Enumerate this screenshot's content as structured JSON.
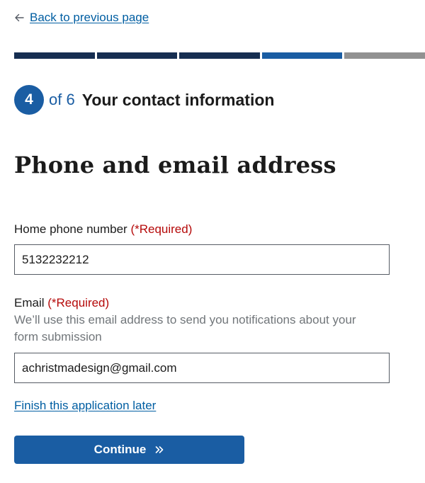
{
  "nav": {
    "back_label": "Back to previous page",
    "back_icon": "arrow-left-icon"
  },
  "progress": {
    "total_segments": 5,
    "segments": [
      "done",
      "done",
      "done",
      "current",
      "todo"
    ],
    "colors": {
      "done": "#162e51",
      "current": "#1a5da3",
      "todo": "#919191"
    }
  },
  "step": {
    "number": "4",
    "of_label": "of 6",
    "title": "Your contact information"
  },
  "page": {
    "title": "Phone and email address"
  },
  "form": {
    "phone": {
      "label": "Home phone number",
      "required_label": "(*Required)",
      "value": "5132232212"
    },
    "email": {
      "label": "Email",
      "required_label": "(*Required)",
      "hint": "We’ll use this email address to send you notifications about your form submission",
      "value": "achristmadesign@gmail.com"
    }
  },
  "actions": {
    "finish_later_label": "Finish this application later",
    "continue_label": "Continue",
    "continue_icon": "double-chevron-right-icon"
  },
  "colors": {
    "primary": "#1a5da3",
    "link": "#005ea2",
    "required": "#b50909",
    "hint": "#71767a",
    "dark_navy": "#162e51"
  }
}
